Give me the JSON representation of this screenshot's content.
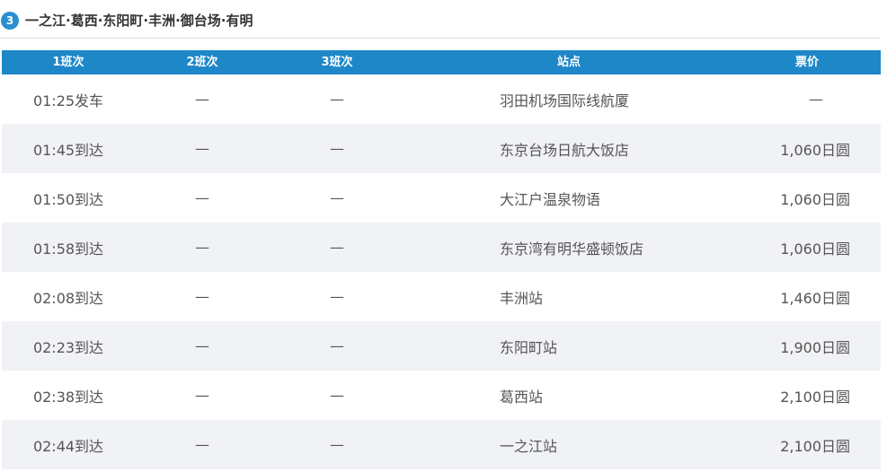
{
  "header": {
    "number": "3",
    "title": "一之江·葛西·东阳町·丰洲·御台场·有明"
  },
  "table": {
    "columns": [
      "1班次",
      "2班次",
      "3班次",
      "站点",
      "票价"
    ],
    "rows": [
      {
        "trip1": "01:25发车",
        "trip2": "—",
        "trip3": "—",
        "station": "羽田机场国际线航厦",
        "fare": "—"
      },
      {
        "trip1": "01:45到达",
        "trip2": "—",
        "trip3": "—",
        "station": "东京台场日航大饭店",
        "fare": "1,060日圆"
      },
      {
        "trip1": "01:50到达",
        "trip2": "—",
        "trip3": "—",
        "station": "大江户温泉物语",
        "fare": "1,060日圆"
      },
      {
        "trip1": "01:58到达",
        "trip2": "—",
        "trip3": "—",
        "station": "东京湾有明华盛顿饭店",
        "fare": "1,060日圆"
      },
      {
        "trip1": "02:08到达",
        "trip2": "—",
        "trip3": "—",
        "station": "丰洲站",
        "fare": "1,460日圆"
      },
      {
        "trip1": "02:23到达",
        "trip2": "—",
        "trip3": "—",
        "station": "东阳町站",
        "fare": "1,900日圆"
      },
      {
        "trip1": "02:38到达",
        "trip2": "—",
        "trip3": "—",
        "station": "葛西站",
        "fare": "2,100日圆"
      },
      {
        "trip1": "02:44到达",
        "trip2": "—",
        "trip3": "—",
        "station": "一之江站",
        "fare": "2,100日圆"
      }
    ]
  },
  "colors": {
    "header_bg": "#1d87c8",
    "badge_bg": "#2b8fcf",
    "stripe_bg": "#f0f2f5"
  }
}
